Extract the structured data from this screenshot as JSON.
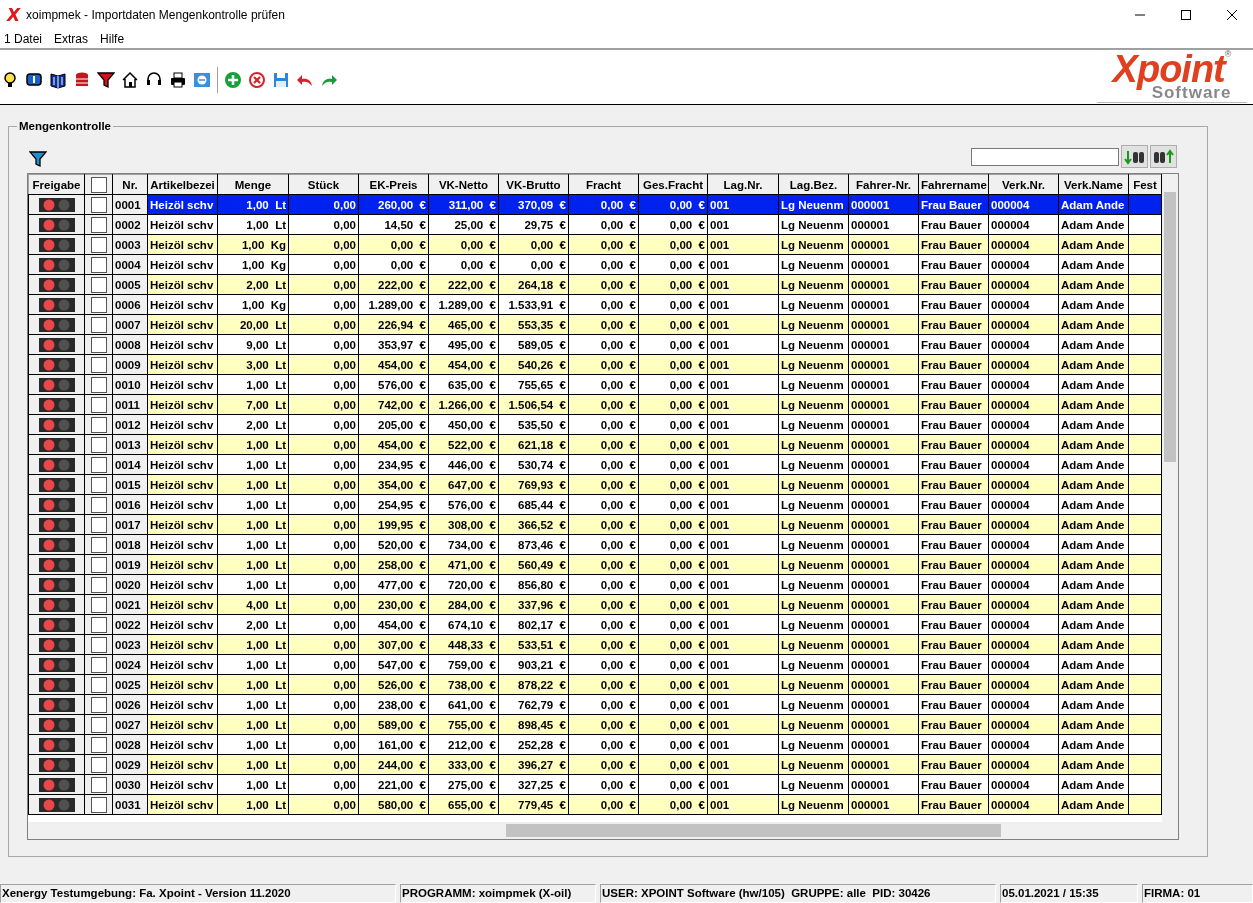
{
  "window": {
    "app_letter": "X",
    "title": "xoimpmek - Importdaten Mengenkontrolle prüfen"
  },
  "menu": [
    "1 Datei",
    "Extras",
    "Hilfe"
  ],
  "logo": {
    "word": "Xpoint",
    "sub": "Software",
    "mark": "®"
  },
  "group": {
    "title": "Mengenkontrolle"
  },
  "table": {
    "columns": [
      "Freigabe",
      {
        "kind": "checkbox",
        "checked": false
      },
      "Nr.",
      "Artikelbezei",
      "Menge",
      "Stück",
      "EK-Preis",
      "VK-Netto",
      "VK-Brutto",
      "Fracht",
      "Ges.Fracht",
      "Lag.Nr.",
      "Lag.Bez.",
      "Fahrer-Nr.",
      "Fahrername",
      "Verk.Nr.",
      "Verk.Name",
      "Fest"
    ],
    "rows": [
      {
        "selected": true,
        "cells": [
          {
            "kind": "traffic_light"
          },
          {
            "kind": "checkbox",
            "checked": false
          },
          "0001",
          "Heizöl schv",
          "1,00  Lt",
          "0,00",
          "260,00  €",
          "311,00  €",
          "370,09  €",
          "0,00  €",
          "0,00  €",
          "001",
          "Lg Neuenm",
          "000001",
          "Frau Bauer",
          "000004",
          "Adam Ande"
        ]
      },
      {
        "selected": false,
        "cells": [
          {
            "kind": "traffic_light"
          },
          {
            "kind": "checkbox",
            "checked": false
          },
          "0002",
          "Heizöl schv",
          "1,00  Lt",
          "0,00",
          "14,50  €",
          "25,00  €",
          "29,75  €",
          "0,00  €",
          "0,00  €",
          "001",
          "Lg Neuenm",
          "000001",
          "Frau Bauer",
          "000004",
          "Adam Ande"
        ]
      },
      {
        "selected": false,
        "cells": [
          {
            "kind": "traffic_light"
          },
          {
            "kind": "checkbox",
            "checked": false
          },
          "0003",
          "Heizöl schv",
          "1,00  Kg",
          "0,00",
          "0,00  €",
          "0,00  €",
          "0,00  €",
          "0,00  €",
          "0,00  €",
          "001",
          "Lg Neuenm",
          "000001",
          "Frau Bauer",
          "000004",
          "Adam Ande"
        ]
      },
      {
        "selected": false,
        "cells": [
          {
            "kind": "traffic_light"
          },
          {
            "kind": "checkbox",
            "checked": false
          },
          "0004",
          "Heizöl schv",
          "1,00  Kg",
          "0,00",
          "0,00  €",
          "0,00  €",
          "0,00  €",
          "0,00  €",
          "0,00  €",
          "001",
          "Lg Neuenm",
          "000001",
          "Frau Bauer",
          "000004",
          "Adam Ande"
        ]
      },
      {
        "selected": false,
        "cells": [
          {
            "kind": "traffic_light"
          },
          {
            "kind": "checkbox",
            "checked": false
          },
          "0005",
          "Heizöl schv",
          "2,00  Lt",
          "0,00",
          "222,00  €",
          "222,00  €",
          "264,18  €",
          "0,00  €",
          "0,00  €",
          "001",
          "Lg Neuenm",
          "000001",
          "Frau Bauer",
          "000004",
          "Adam Ande"
        ]
      },
      {
        "selected": false,
        "cells": [
          {
            "kind": "traffic_light"
          },
          {
            "kind": "checkbox",
            "checked": false
          },
          "0006",
          "Heizöl schv",
          "1,00  Kg",
          "0,00",
          "1.289,00  €",
          "1.289,00  €",
          "1.533,91  €",
          "0,00  €",
          "0,00  €",
          "001",
          "Lg Neuenm",
          "000001",
          "Frau Bauer",
          "000004",
          "Adam Ande"
        ]
      },
      {
        "selected": false,
        "cells": [
          {
            "kind": "traffic_light"
          },
          {
            "kind": "checkbox",
            "checked": false
          },
          "0007",
          "Heizöl schv",
          "20,00  Lt",
          "0,00",
          "226,94  €",
          "465,00  €",
          "553,35  €",
          "0,00  €",
          "0,00  €",
          "001",
          "Lg Neuenm",
          "000001",
          "Frau Bauer",
          "000004",
          "Adam Ande"
        ]
      },
      {
        "selected": false,
        "cells": [
          {
            "kind": "traffic_light"
          },
          {
            "kind": "checkbox",
            "checked": false
          },
          "0008",
          "Heizöl schv",
          "9,00  Lt",
          "0,00",
          "353,97  €",
          "495,00  €",
          "589,05  €",
          "0,00  €",
          "0,00  €",
          "001",
          "Lg Neuenm",
          "000001",
          "Frau Bauer",
          "000004",
          "Adam Ande"
        ]
      },
      {
        "selected": false,
        "cells": [
          {
            "kind": "traffic_light"
          },
          {
            "kind": "checkbox",
            "checked": false
          },
          "0009",
          "Heizöl schv",
          "3,00  Lt",
          "0,00",
          "454,00  €",
          "454,00  €",
          "540,26  €",
          "0,00  €",
          "0,00  €",
          "001",
          "Lg Neuenm",
          "000001",
          "Frau Bauer",
          "000004",
          "Adam Ande"
        ]
      },
      {
        "selected": false,
        "cells": [
          {
            "kind": "traffic_light"
          },
          {
            "kind": "checkbox",
            "checked": false
          },
          "0010",
          "Heizöl schv",
          "1,00  Lt",
          "0,00",
          "576,00  €",
          "635,00  €",
          "755,65  €",
          "0,00  €",
          "0,00  €",
          "001",
          "Lg Neuenm",
          "000001",
          "Frau Bauer",
          "000004",
          "Adam Ande"
        ]
      },
      {
        "selected": false,
        "cells": [
          {
            "kind": "traffic_light"
          },
          {
            "kind": "checkbox",
            "checked": false
          },
          "0011",
          "Heizöl schv",
          "7,00  Lt",
          "0,00",
          "742,00  €",
          "1.266,00  €",
          "1.506,54  €",
          "0,00  €",
          "0,00  €",
          "001",
          "Lg Neuenm",
          "000001",
          "Frau Bauer",
          "000004",
          "Adam Ande"
        ]
      },
      {
        "selected": false,
        "cells": [
          {
            "kind": "traffic_light"
          },
          {
            "kind": "checkbox",
            "checked": false
          },
          "0012",
          "Heizöl schv",
          "2,00  Lt",
          "0,00",
          "205,00  €",
          "450,00  €",
          "535,50  €",
          "0,00  €",
          "0,00  €",
          "001",
          "Lg Neuenm",
          "000001",
          "Frau Bauer",
          "000004",
          "Adam Ande"
        ]
      },
      {
        "selected": false,
        "cells": [
          {
            "kind": "traffic_light"
          },
          {
            "kind": "checkbox",
            "checked": false
          },
          "0013",
          "Heizöl schv",
          "1,00  Lt",
          "0,00",
          "454,00  €",
          "522,00  €",
          "621,18  €",
          "0,00  €",
          "0,00  €",
          "001",
          "Lg Neuenm",
          "000001",
          "Frau Bauer",
          "000004",
          "Adam Ande"
        ]
      },
      {
        "selected": false,
        "cells": [
          {
            "kind": "traffic_light"
          },
          {
            "kind": "checkbox",
            "checked": false
          },
          "0014",
          "Heizöl schv",
          "1,00  Lt",
          "0,00",
          "234,95  €",
          "446,00  €",
          "530,74  €",
          "0,00  €",
          "0,00  €",
          "001",
          "Lg Neuenm",
          "000001",
          "Frau Bauer",
          "000004",
          "Adam Ande"
        ]
      },
      {
        "selected": false,
        "cells": [
          {
            "kind": "traffic_light"
          },
          {
            "kind": "checkbox",
            "checked": false
          },
          "0015",
          "Heizöl schv",
          "1,00  Lt",
          "0,00",
          "354,00  €",
          "647,00  €",
          "769,93  €",
          "0,00  €",
          "0,00  €",
          "001",
          "Lg Neuenm",
          "000001",
          "Frau Bauer",
          "000004",
          "Adam Ande"
        ]
      },
      {
        "selected": false,
        "cells": [
          {
            "kind": "traffic_light"
          },
          {
            "kind": "checkbox",
            "checked": false
          },
          "0016",
          "Heizöl schv",
          "1,00  Lt",
          "0,00",
          "254,95  €",
          "576,00  €",
          "685,44  €",
          "0,00  €",
          "0,00  €",
          "001",
          "Lg Neuenm",
          "000001",
          "Frau Bauer",
          "000004",
          "Adam Ande"
        ]
      },
      {
        "selected": false,
        "cells": [
          {
            "kind": "traffic_light"
          },
          {
            "kind": "checkbox",
            "checked": false
          },
          "0017",
          "Heizöl schv",
          "1,00  Lt",
          "0,00",
          "199,95  €",
          "308,00  €",
          "366,52  €",
          "0,00  €",
          "0,00  €",
          "001",
          "Lg Neuenm",
          "000001",
          "Frau Bauer",
          "000004",
          "Adam Ande"
        ]
      },
      {
        "selected": false,
        "cells": [
          {
            "kind": "traffic_light"
          },
          {
            "kind": "checkbox",
            "checked": false
          },
          "0018",
          "Heizöl schv",
          "1,00  Lt",
          "0,00",
          "520,00  €",
          "734,00  €",
          "873,46  €",
          "0,00  €",
          "0,00  €",
          "001",
          "Lg Neuenm",
          "000001",
          "Frau Bauer",
          "000004",
          "Adam Ande"
        ]
      },
      {
        "selected": false,
        "cells": [
          {
            "kind": "traffic_light"
          },
          {
            "kind": "checkbox",
            "checked": false
          },
          "0019",
          "Heizöl schv",
          "1,00  Lt",
          "0,00",
          "258,00  €",
          "471,00  €",
          "560,49  €",
          "0,00  €",
          "0,00  €",
          "001",
          "Lg Neuenm",
          "000001",
          "Frau Bauer",
          "000004",
          "Adam Ande"
        ]
      },
      {
        "selected": false,
        "cells": [
          {
            "kind": "traffic_light"
          },
          {
            "kind": "checkbox",
            "checked": false
          },
          "0020",
          "Heizöl schv",
          "1,00  Lt",
          "0,00",
          "477,00  €",
          "720,00  €",
          "856,80  €",
          "0,00  €",
          "0,00  €",
          "001",
          "Lg Neuenm",
          "000001",
          "Frau Bauer",
          "000004",
          "Adam Ande"
        ]
      },
      {
        "selected": false,
        "cells": [
          {
            "kind": "traffic_light"
          },
          {
            "kind": "checkbox",
            "checked": false
          },
          "0021",
          "Heizöl schv",
          "4,00  Lt",
          "0,00",
          "230,00  €",
          "284,00  €",
          "337,96  €",
          "0,00  €",
          "0,00  €",
          "001",
          "Lg Neuenm",
          "000001",
          "Frau Bauer",
          "000004",
          "Adam Ande"
        ]
      },
      {
        "selected": false,
        "cells": [
          {
            "kind": "traffic_light"
          },
          {
            "kind": "checkbox",
            "checked": false
          },
          "0022",
          "Heizöl schv",
          "2,00  Lt",
          "0,00",
          "454,00  €",
          "674,10  €",
          "802,17  €",
          "0,00  €",
          "0,00  €",
          "001",
          "Lg Neuenm",
          "000001",
          "Frau Bauer",
          "000004",
          "Adam Ande"
        ]
      },
      {
        "selected": false,
        "cells": [
          {
            "kind": "traffic_light"
          },
          {
            "kind": "checkbox",
            "checked": false
          },
          "0023",
          "Heizöl schv",
          "1,00  Lt",
          "0,00",
          "307,00  €",
          "448,33  €",
          "533,51  €",
          "0,00  €",
          "0,00  €",
          "001",
          "Lg Neuenm",
          "000001",
          "Frau Bauer",
          "000004",
          "Adam Ande"
        ]
      },
      {
        "selected": false,
        "cells": [
          {
            "kind": "traffic_light"
          },
          {
            "kind": "checkbox",
            "checked": false
          },
          "0024",
          "Heizöl schv",
          "1,00  Lt",
          "0,00",
          "547,00  €",
          "759,00  €",
          "903,21  €",
          "0,00  €",
          "0,00  €",
          "001",
          "Lg Neuenm",
          "000001",
          "Frau Bauer",
          "000004",
          "Adam Ande"
        ]
      },
      {
        "selected": false,
        "cells": [
          {
            "kind": "traffic_light"
          },
          {
            "kind": "checkbox",
            "checked": false
          },
          "0025",
          "Heizöl schv",
          "1,00  Lt",
          "0,00",
          "526,00  €",
          "738,00  €",
          "878,22  €",
          "0,00  €",
          "0,00  €",
          "001",
          "Lg Neuenm",
          "000001",
          "Frau Bauer",
          "000004",
          "Adam Ande"
        ]
      },
      {
        "selected": false,
        "cells": [
          {
            "kind": "traffic_light"
          },
          {
            "kind": "checkbox",
            "checked": false
          },
          "0026",
          "Heizöl schv",
          "1,00  Lt",
          "0,00",
          "238,00  €",
          "641,00  €",
          "762,79  €",
          "0,00  €",
          "0,00  €",
          "001",
          "Lg Neuenm",
          "000001",
          "Frau Bauer",
          "000004",
          "Adam Ande"
        ]
      },
      {
        "selected": false,
        "cells": [
          {
            "kind": "traffic_light"
          },
          {
            "kind": "checkbox",
            "checked": false
          },
          "0027",
          "Heizöl schv",
          "1,00  Lt",
          "0,00",
          "589,00  €",
          "755,00  €",
          "898,45  €",
          "0,00  €",
          "0,00  €",
          "001",
          "Lg Neuenm",
          "000001",
          "Frau Bauer",
          "000004",
          "Adam Ande"
        ]
      },
      {
        "selected": false,
        "cells": [
          {
            "kind": "traffic_light"
          },
          {
            "kind": "checkbox",
            "checked": false
          },
          "0028",
          "Heizöl schv",
          "1,00  Lt",
          "0,00",
          "161,00  €",
          "212,00  €",
          "252,28  €",
          "0,00  €",
          "0,00  €",
          "001",
          "Lg Neuenm",
          "000001",
          "Frau Bauer",
          "000004",
          "Adam Ande"
        ]
      },
      {
        "selected": false,
        "cells": [
          {
            "kind": "traffic_light"
          },
          {
            "kind": "checkbox",
            "checked": false
          },
          "0029",
          "Heizöl schv",
          "1,00  Lt",
          "0,00",
          "244,00  €",
          "333,00  €",
          "396,27  €",
          "0,00  €",
          "0,00  €",
          "001",
          "Lg Neuenm",
          "000001",
          "Frau Bauer",
          "000004",
          "Adam Ande"
        ]
      },
      {
        "selected": false,
        "cells": [
          {
            "kind": "traffic_light"
          },
          {
            "kind": "checkbox",
            "checked": false
          },
          "0030",
          "Heizöl schv",
          "1,00  Lt",
          "0,00",
          "221,00  €",
          "275,00  €",
          "327,25  €",
          "0,00  €",
          "0,00  €",
          "001",
          "Lg Neuenm",
          "000001",
          "Frau Bauer",
          "000004",
          "Adam Ande"
        ]
      },
      {
        "selected": false,
        "cells": [
          {
            "kind": "traffic_light"
          },
          {
            "kind": "checkbox",
            "checked": false
          },
          "0031",
          "Heizöl schv",
          "1,00  Lt",
          "0,00",
          "580,00  €",
          "655,00  €",
          "779,45  €",
          "0,00  €",
          "0,00  €",
          "001",
          "Lg Neuenm",
          "000001",
          "Frau Bauer",
          "000004",
          "Adam Ande"
        ]
      }
    ]
  },
  "status_bar": [
    "Xenergy Testumgebung: Fa. Xpoint - Version 11.2020",
    "PROGRAMM: xoimpmek (X-oil)",
    "USER: XPOINT Software (hw/105)  GRUPPE: alle  PID: 30426",
    "05.01.2021 / 15:35",
    "FIRMA: 01"
  ]
}
